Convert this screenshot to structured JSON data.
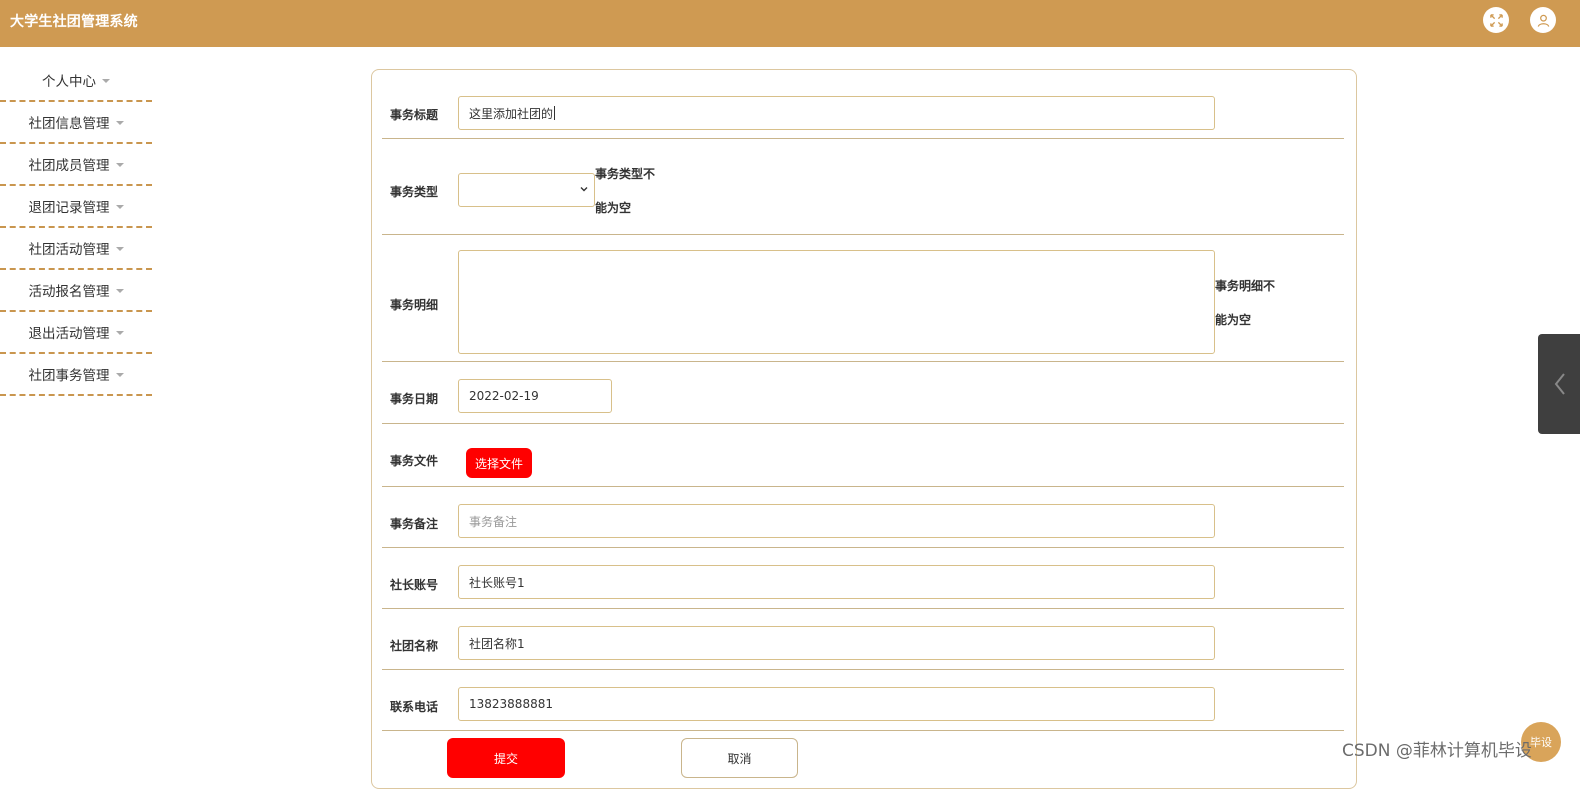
{
  "app": {
    "title": "大学生社团管理系统"
  },
  "header": {
    "icons": [
      "fullscreen-icon",
      "user-icon"
    ]
  },
  "sidebar": {
    "items": [
      {
        "label": "个人中心"
      },
      {
        "label": "社团信息管理"
      },
      {
        "label": "社团成员管理"
      },
      {
        "label": "退团记录管理"
      },
      {
        "label": "社团活动管理"
      },
      {
        "label": "活动报名管理"
      },
      {
        "label": "退出活动管理"
      },
      {
        "label": "社团事务管理"
      }
    ]
  },
  "form": {
    "title_label": "事务标题",
    "title_value": "这里添加社团的",
    "type_label": "事务类型",
    "type_value": "",
    "type_error_line1": "事务类型不",
    "type_error_line2": "能为空",
    "detail_label": "事务明细",
    "detail_value": "",
    "detail_error_line1": "事务明细不",
    "detail_error_line2": "能为空",
    "date_label": "事务日期",
    "date_value": "2022-02-19",
    "file_label": "事务文件",
    "file_button": "选择文件",
    "remark_label": "事务备注",
    "remark_placeholder": "事务备注",
    "leader_label": "社长账号",
    "leader_value": "社长账号1",
    "club_label": "社团名称",
    "club_value": "社团名称1",
    "phone_label": "联系电话",
    "phone_value": "13823888881",
    "submit": "提交",
    "cancel": "取消"
  },
  "watermark": "CSDN @菲林计算机毕设",
  "float_badge": "毕设",
  "colors": {
    "header": "#cf9a52",
    "primary_button": "#ff0000",
    "divider": "#c9964f"
  }
}
